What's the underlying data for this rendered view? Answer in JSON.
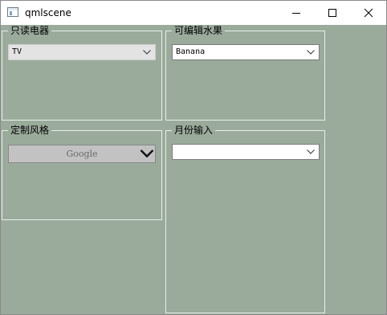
{
  "window": {
    "title": "qmlscene"
  },
  "groups": {
    "readonly_appliance": {
      "label": "只读电器",
      "selected": "TV"
    },
    "editable_fruit": {
      "label": "可编辑水果",
      "selected": "Banana"
    },
    "custom_style": {
      "label": "定制风格",
      "selected": "Google"
    },
    "month_input": {
      "label": "月份输入",
      "value": ""
    }
  },
  "icons": {
    "app": "window-app-icon",
    "minimize": "minimize-icon",
    "maximize": "maximize-icon",
    "close": "close-icon",
    "dropdown": "chevron-down-icon"
  },
  "colors": {
    "background": "#9aab9c",
    "group_border": "#e9efe9",
    "titlebar": "#ffffff"
  }
}
